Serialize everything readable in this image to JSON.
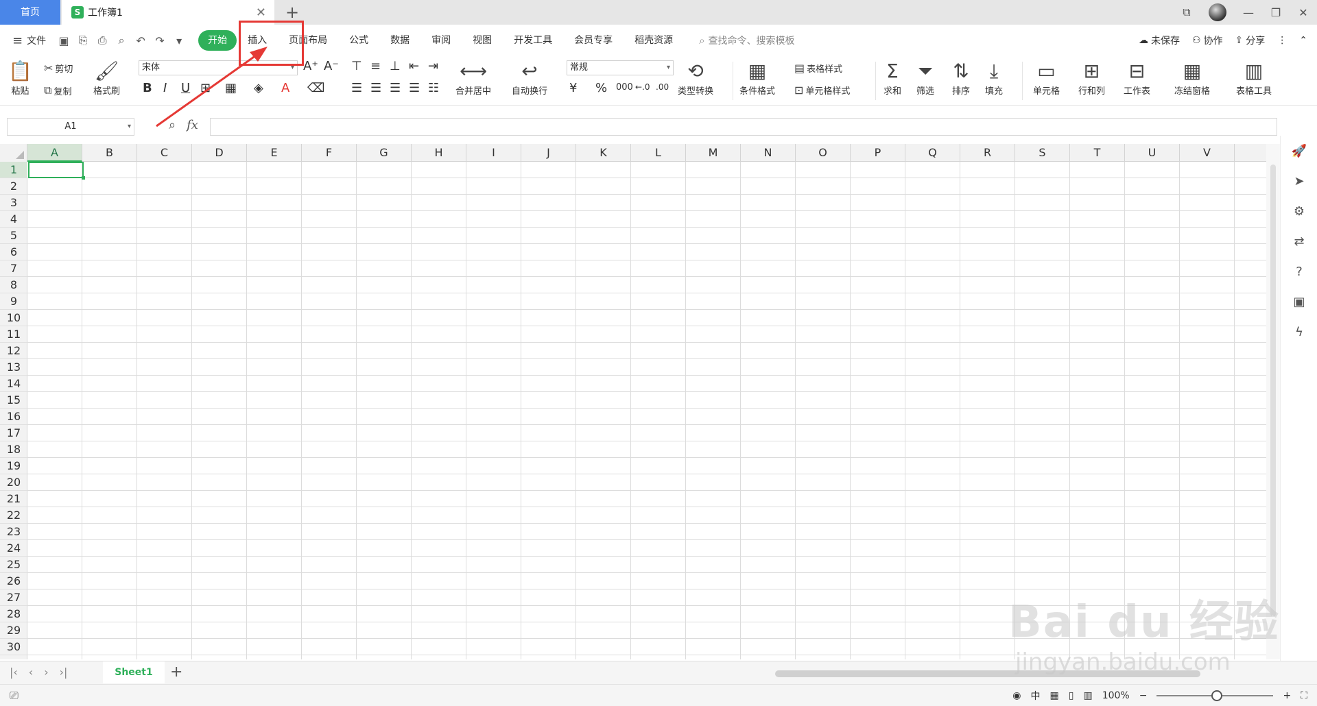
{
  "titlebar": {
    "home_tab": "首页",
    "doc_badge": "S",
    "doc_title": "工作簿1"
  },
  "menu": {
    "file": "文件",
    "tabs": [
      "开始",
      "插入",
      "页面布局",
      "公式",
      "数据",
      "审阅",
      "视图",
      "开发工具",
      "会员专享",
      "稻壳资源"
    ],
    "active_tab": "开始",
    "search_placeholder": "查找命令、搜索模板",
    "unsaved": "未保存",
    "collab": "协作",
    "share": "分享"
  },
  "ribbon": {
    "paste": "粘贴",
    "cut": "剪切",
    "copy": "复制",
    "format_painter": "格式刷",
    "font_name": "宋体",
    "merge_center": "合并居中",
    "wrap_text": "自动换行",
    "number_format": "常规",
    "type_convert": "类型转换",
    "cond_format": "条件格式",
    "table_style": "表格样式",
    "cell_style": "单元格样式",
    "sum": "求和",
    "filter": "筛选",
    "sort": "排序",
    "fill": "填充",
    "cell": "单元格",
    "row_col": "行和列",
    "worksheet": "工作表",
    "freeze": "冻结窗格",
    "table_tools": "表格工具"
  },
  "formula_bar": {
    "name_box": "A1",
    "fx": "fx",
    "formula": ""
  },
  "grid": {
    "columns": [
      "A",
      "B",
      "C",
      "D",
      "E",
      "F",
      "G",
      "H",
      "I",
      "J",
      "K",
      "L",
      "M",
      "N",
      "O",
      "P",
      "Q",
      "R",
      "S",
      "T",
      "U",
      "V"
    ],
    "rows": [
      "1",
      "2",
      "3",
      "4",
      "5",
      "6",
      "7",
      "8",
      "9",
      "10",
      "11",
      "12",
      "13",
      "14",
      "15",
      "16",
      "17",
      "18",
      "19",
      "20",
      "21",
      "22",
      "23",
      "24",
      "25",
      "26",
      "27",
      "28",
      "29",
      "30"
    ],
    "selected_cell": "A1"
  },
  "sheets": {
    "active": "Sheet1"
  },
  "status": {
    "zoom": "100%"
  },
  "watermark": {
    "brand": "Bai du 经验",
    "url": "jingyan.baidu.com"
  },
  "colors": {
    "accent": "#2fb05a",
    "annotation": "#e53935",
    "home_tab": "#4a86e8"
  }
}
